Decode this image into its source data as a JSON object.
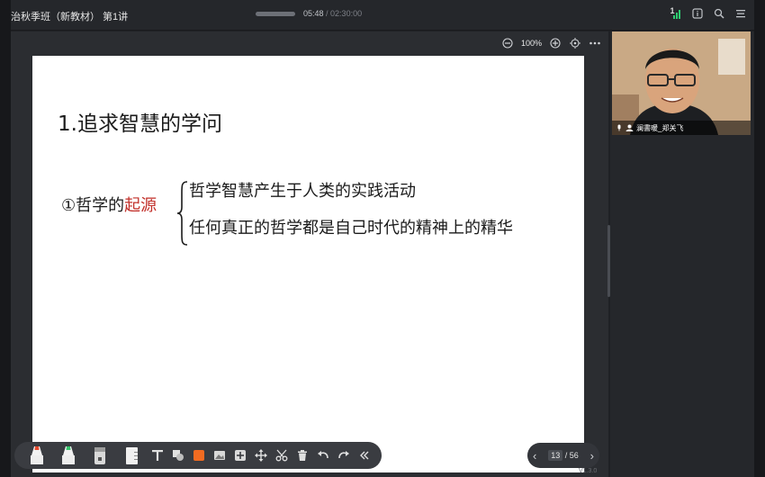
{
  "course": {
    "title": "治秋季班（新教材） 第1讲"
  },
  "playback": {
    "current": "05:48",
    "separator": " / ",
    "total": "02:30:00"
  },
  "topbar": {
    "signal_label": "1"
  },
  "zoom": {
    "level": "100%"
  },
  "slide": {
    "heading": "1.追求智慧的学问",
    "origin_prefix": "①哲学的",
    "origin_accent": "起源",
    "point_1": "哲学智慧产生于人类的实践活动",
    "point_2": "任何真正的哲学都是自己时代的精神上的精华"
  },
  "pager": {
    "current": "13",
    "separator": " / ",
    "total": "56"
  },
  "video": {
    "name": "澜書暖_郑关飞"
  },
  "version": "V1.3.0",
  "colors": {
    "accent": "#c2302a",
    "slide_bg": "#ffffff",
    "chrome": "#25272b",
    "toolbar": "#3a3c41",
    "highlight_tool": "#f26b21"
  }
}
